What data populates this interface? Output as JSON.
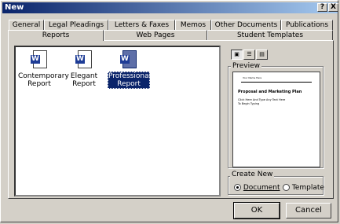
{
  "window": {
    "title": "New"
  },
  "titlebar_buttons": {
    "help": "?",
    "close": "X"
  },
  "tabs_row1": [
    "General",
    "Legal Pleadings",
    "Letters & Faxes",
    "Memos",
    "Other Documents",
    "Publications"
  ],
  "tabs_row2": [
    "Reports",
    "Web Pages",
    "Student Templates"
  ],
  "active_tab": "Reports",
  "templates": [
    {
      "label_line1": "Contemporary",
      "label_line2": "Report",
      "icon": "word-document-icon"
    },
    {
      "label_line1": "Elegant",
      "label_line2": "Report",
      "icon": "word-document-icon"
    },
    {
      "label_line1": "Professional",
      "label_line2": "Report",
      "icon": "word-document-icon",
      "selected": true
    }
  ],
  "preview": {
    "label": "Preview",
    "doc_title": "Proposal and Marketing Plan",
    "doc_header": "Your Name Here",
    "doc_body": "Click Here And Type Any Text Here To Begin Typing"
  },
  "create_new": {
    "label": "Create New",
    "options": [
      "Document",
      "Template"
    ],
    "selected": "Document"
  },
  "buttons": {
    "ok": "OK",
    "cancel": "Cancel"
  }
}
